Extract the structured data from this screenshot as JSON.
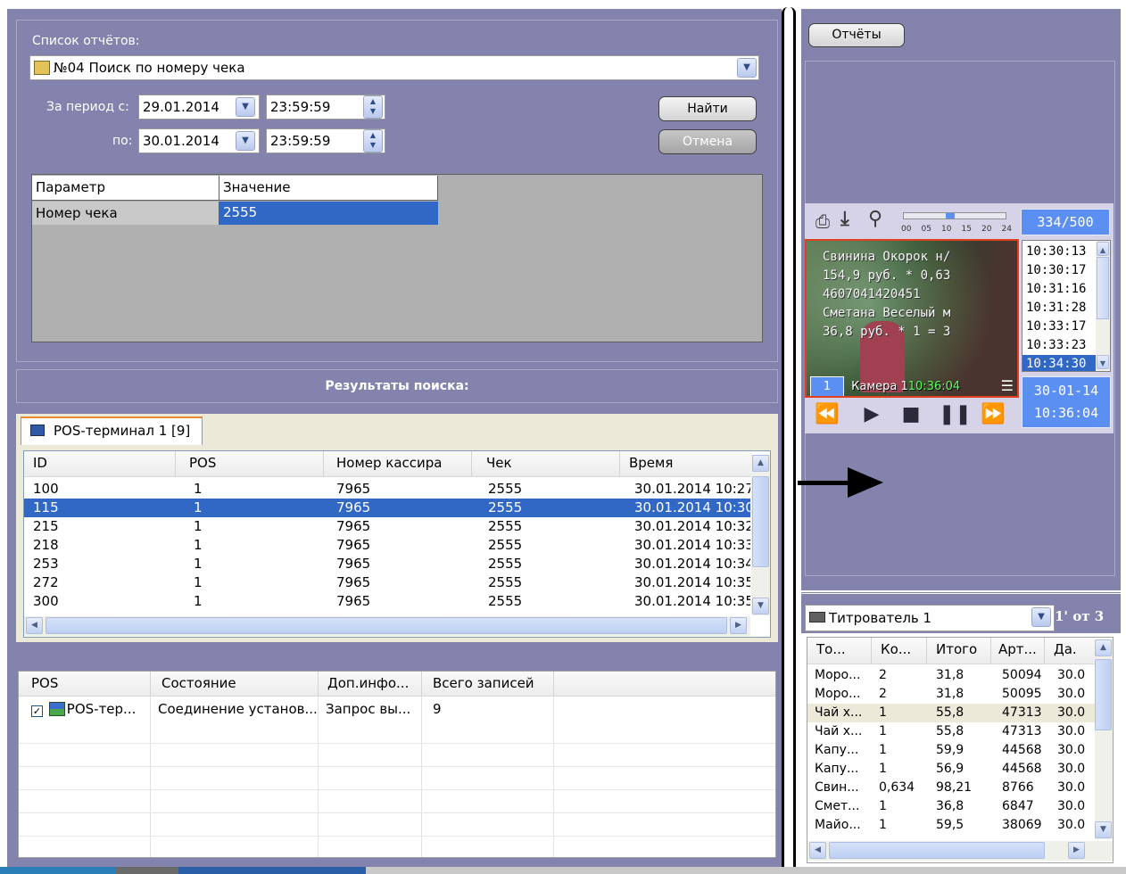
{
  "report_panel": {
    "reports_list_label": "Список отчётов:",
    "report_selected": "№04 Поиск по номеру чека",
    "period_from_label": "За период с:",
    "period_to_label": "по:",
    "date_from": "29.01.2014",
    "time_from": "23:59:59",
    "date_to": "30.01.2014",
    "time_to": "23:59:59",
    "find_button": "Найти",
    "cancel_button": "Отмена",
    "param_header": "Параметр",
    "value_header": "Значение",
    "param_name": "Номер чека",
    "param_value": "2555",
    "results_title": "Результаты поиска:"
  },
  "results": {
    "tab_label": "POS-терминал 1 [9]",
    "columns": [
      "ID",
      "POS",
      "Номер кассира",
      "Чек",
      "Время"
    ],
    "rows": [
      [
        "100",
        "1",
        "7965",
        "2555",
        "30.01.2014 10:27:"
      ],
      [
        "115",
        "1",
        "7965",
        "2555",
        "30.01.2014 10:30:"
      ],
      [
        "215",
        "1",
        "7965",
        "2555",
        "30.01.2014 10:32:"
      ],
      [
        "218",
        "1",
        "7965",
        "2555",
        "30.01.2014 10:33:"
      ],
      [
        "253",
        "1",
        "7965",
        "2555",
        "30.01.2014 10:34:"
      ],
      [
        "272",
        "1",
        "7965",
        "2555",
        "30.01.2014 10:35:"
      ],
      [
        "300",
        "1",
        "7965",
        "2555",
        "30.01.2014 10:35:"
      ]
    ],
    "selected_row": 1
  },
  "pos_status": {
    "columns": [
      "POS",
      "Состояние",
      "Доп.инфо...",
      "Всего записей"
    ],
    "row": [
      "POS-тер...",
      "Соединение установ...",
      "Запрос вы...",
      "9"
    ]
  },
  "video_panel": {
    "reports_button": "Отчёты",
    "counter": "334/500",
    "timeline_ticks": [
      "00",
      "05",
      "10",
      "15",
      "20",
      "24"
    ],
    "overlay_lines": [
      "Свинина Окорок н/",
      "154,9 руб. * 0,63",
      "4607041420451",
      "Сметана Веселый м",
      "36,8 руб. * 1 = 3"
    ],
    "camera_number": "1",
    "camera_label": "Камера 1",
    "camera_time": "10:36:04",
    "time_list": [
      "10:30:13",
      "10:30:17",
      "10:31:16",
      "10:31:28",
      "10:33:17",
      "10:33:23",
      "10:34:30"
    ],
    "selected_time_index": 6,
    "date_display": "30-01-14",
    "time_display": "10:36:04"
  },
  "titler_panel": {
    "titler_selected": "Титрователь 1",
    "page_info": "1' от 3",
    "columns": [
      "То...",
      "Ко...",
      "Итого",
      "Арт...",
      "Да."
    ],
    "rows": [
      [
        "Моро...",
        "2",
        "31,8",
        "50094",
        "30.0"
      ],
      [
        "Моро...",
        "2",
        "31,8",
        "50095",
        "30.0"
      ],
      [
        "Чай х...",
        "1",
        "55,8",
        "47313",
        "30.0"
      ],
      [
        "Чай х...",
        "1",
        "55,8",
        "47313",
        "30.0"
      ],
      [
        "Капу...",
        "1",
        "59,9",
        "44568",
        "30.0"
      ],
      [
        "Капу...",
        "1",
        "56,9",
        "44568",
        "30.0"
      ],
      [
        "Свин...",
        "0,634",
        "98,21",
        "8766",
        "30.0"
      ],
      [
        "Смет...",
        "1",
        "36,8",
        "6847",
        "30.0"
      ],
      [
        "Майо...",
        "1",
        "59,5",
        "38069",
        "30.0"
      ]
    ],
    "highlight_row": 2
  },
  "colors": {
    "panel": "#8383ad",
    "selection": "#3168c5",
    "accent_blue": "#5b8ff2"
  }
}
